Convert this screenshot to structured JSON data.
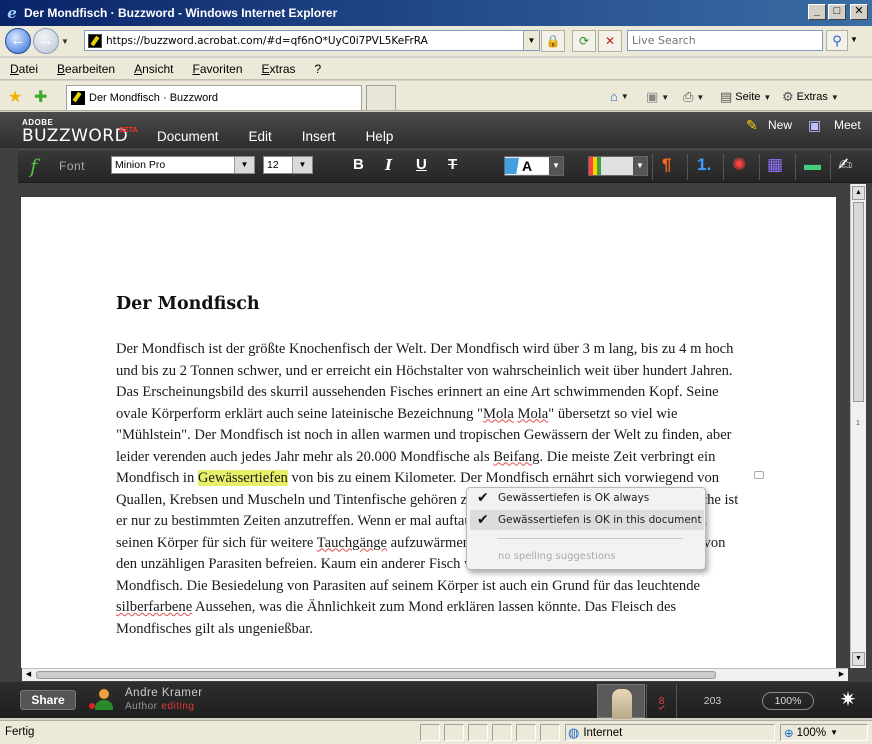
{
  "window": {
    "title": "Der Mondfisch · Buzzword - Windows Internet Explorer"
  },
  "address": {
    "url": "https://buzzword.acrobat.com/#d=qf6nO*UyC0i7PVL5KeFrRA"
  },
  "search": {
    "placeholder": "Live Search"
  },
  "menubar": [
    "Datei",
    "Bearbeiten",
    "Ansicht",
    "Favoriten",
    "Extras",
    "?"
  ],
  "tab": {
    "label": "Der Mondfisch · Buzzword"
  },
  "commandbar": {
    "page": "Seite",
    "tools": "Extras"
  },
  "app": {
    "logo_adobe": "ADOBE",
    "logo_name": "BUZZWORD",
    "logo_beta": "BETA",
    "menu": [
      "Document",
      "Edit",
      "Insert",
      "Help"
    ],
    "new_label": "New",
    "meet_label": "Meet"
  },
  "format": {
    "font_label": "Font",
    "font_value": "Minion Pro",
    "size_value": "12",
    "bold": "B",
    "italic": "I",
    "underline": "U",
    "strike": "T"
  },
  "document": {
    "title": "Der Mondfisch",
    "p_1": "Der Mondfisch ist der größte Knochenfisch der Welt. Der Mondfisch wird über 3 m lang, bis zu 4 m hoch und bis zu 2 Tonnen schwer, und er erreicht ein Höchstalter von wahrscheinlich weit über hundert Jahren. Das Erscheinungsbild des skurril aussehenden Fisches erinnert an eine Art schwimmenden Kopf. Seine ovale Körperform erklärt auch seine lateinische Bezeichnung \"",
    "w_mola1": "Mola",
    "p_2": " ",
    "w_mola2": "Mola",
    "p_3": "\" übersetzt so viel wie \"Mühlstein\". Der Mondfisch ist noch in allen warmen und tropischen Gewässern der Welt zu finden, aber leider verenden auch jedes Jahr mehr als 20.000 Mondfische als ",
    "w_beifang": "Beifang",
    "p_4": ". Die meiste Zeit verbringt ein Mondfisch in ",
    "w_highlight": "Gewässertiefen",
    "p_5": " von bis zu einem Kilometer. Der Mondfisch ernährt sich vorwiegend von Quallen, Krebsen und Muscheln und Tintenfische gehören zu seiner Nahrung. An der Wasseroberfläche ist er nur zu bestimmten Zeiten anzutreffen. Wenn er mal auftauchen sollte, dann zum Sonnenbaden, um seinen Körper für sich für weitere ",
    "w_tauch": "Tauchgänge",
    "p_6": " aufzuwärmen. Außerdem lässt er sich von Seevögeln von den unzähligen Parasiten befreien. Kaum ein anderer Fisch wird mehr von Parasiten befallen wie der Mondfisch. Die Besiedelung von Parasiten auf seinem Körper ist auch ein Grund für das leuchtende ",
    "w_silber": "silberfarbene",
    "p_7": " Aussehen, was die Ähnlichkeit zum Mond erklären lassen könnte. Das Fleisch des Mondfisches gilt als ungenießbar."
  },
  "spell_popup": {
    "item_always": "Gewässertiefen is OK always",
    "item_document": "Gewässertiefen is OK in this document",
    "no_suggestions": "no spelling suggestions"
  },
  "scroll": {
    "page_number": "1"
  },
  "footer": {
    "share": "Share",
    "user_name": "Andre Kramer",
    "user_role": "Author",
    "user_status": "editing",
    "spell_count": "8",
    "word_count": "203",
    "zoom": "100%"
  },
  "statusbar": {
    "status": "Fertig",
    "zone": "Internet",
    "zoom": "100%"
  }
}
